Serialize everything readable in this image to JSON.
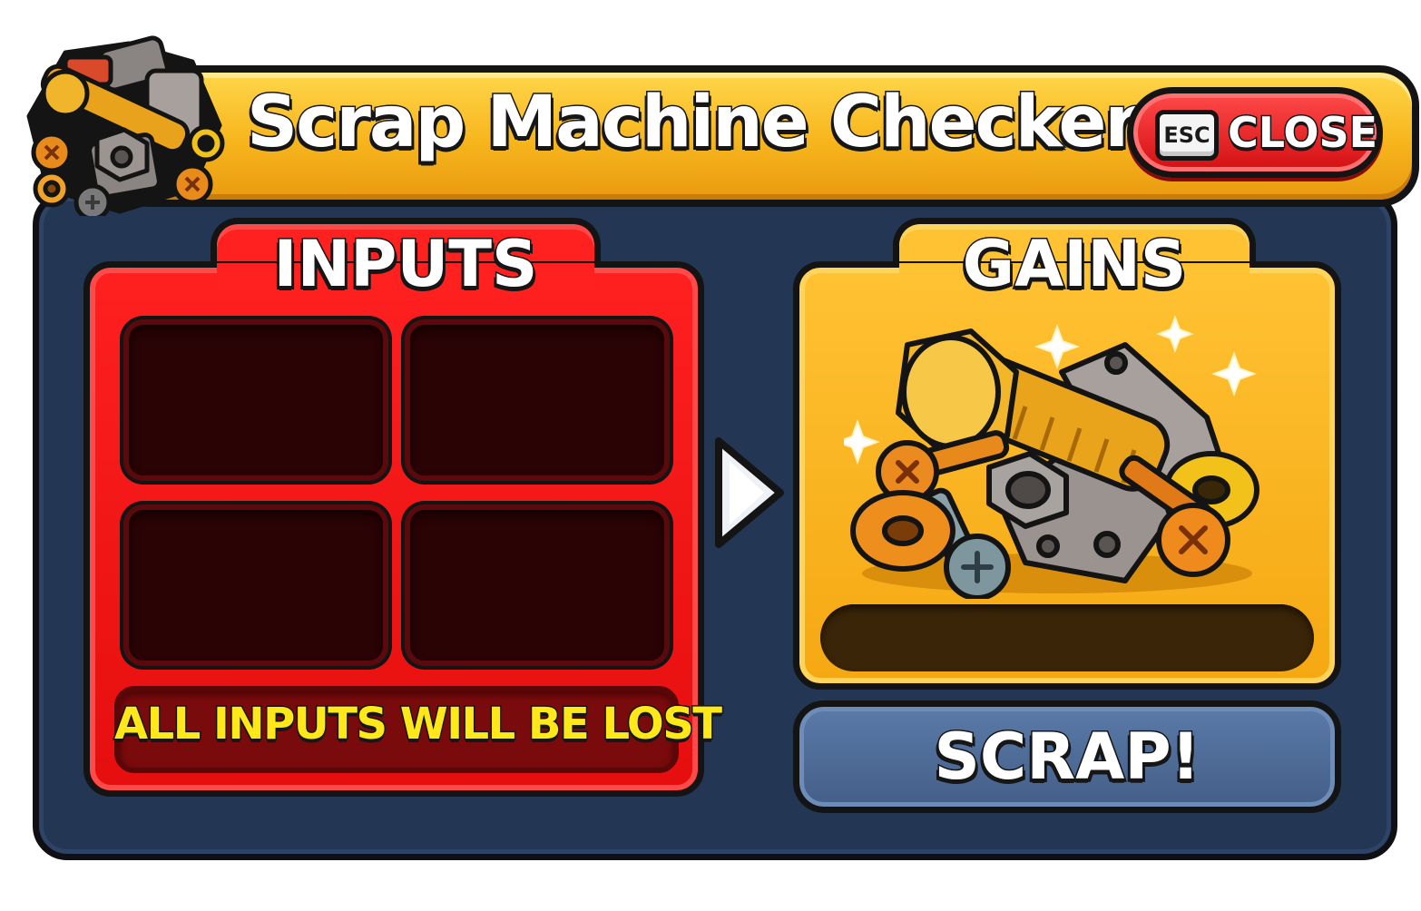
{
  "window": {
    "title": "Scrap Machine Checker",
    "close": {
      "key_label": "ESC",
      "label": "CLOSE"
    }
  },
  "inputs": {
    "title": "INPUTS",
    "slots": [
      "",
      "",
      "",
      ""
    ],
    "warning": "ALL INPUTS WILL BE LOST"
  },
  "gains": {
    "title": "GAINS",
    "icon": "scrap-pile-icon",
    "amount_text": ""
  },
  "action": {
    "label": "SCRAP!"
  },
  "colors": {
    "title_bar": "#f7b51c",
    "panel_bg": "#233653",
    "inputs_panel": "#ff2020",
    "gains_panel": "#ffc233",
    "close_button": "#e0161a",
    "scrap_button": "#5070a0",
    "warning_text": "#ffe81a"
  }
}
